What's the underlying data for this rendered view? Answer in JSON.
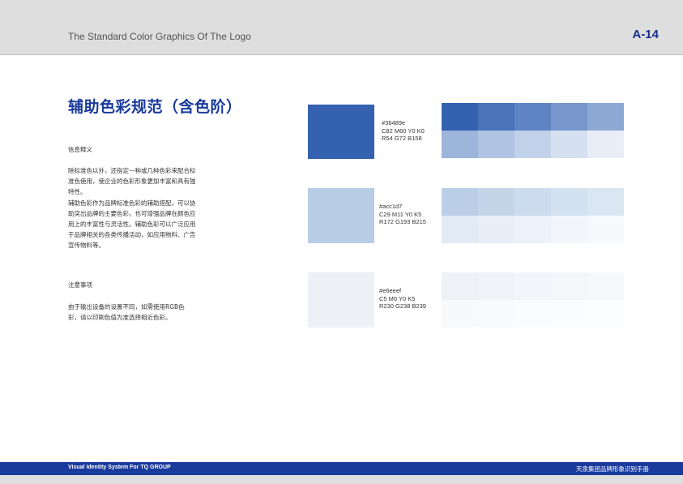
{
  "header": {
    "title": "The Standard Color Graphics Of The Logo",
    "page": "A-14"
  },
  "main_title": "辅助色彩规范（含色阶）",
  "sections": {
    "info_label": "信息释义",
    "info_lines": [
      "除标准色以外，还指定一种或几种色彩来配合标",
      "准色使用，使企业的色彩形象更加丰富和具有独",
      "特性。",
      "辅助色彩作为品牌标准色彩的辅助搭配，可以协",
      "助突出品牌的主要色彩，也可增强品牌在颜色应",
      "用上的丰富性与灵活性。辅助色彩可以广泛应用",
      "于品牌相关的各类传播活动，如应用物料、广告",
      "宣传物料等。"
    ],
    "note_label": "注意事项",
    "note_lines": [
      "由于输出设备的设置不同，如需使用RGB色",
      "彩，请以印刷色值为准选择相近色彩。"
    ]
  },
  "colors": [
    {
      "hex": "#36489e",
      "cmyk": "C82 M60 Y0 K0",
      "rgb": "R54 G72 B158",
      "swatch_color": "#3461b0",
      "tints": [
        [
          "#3461b0",
          "#4a73ba",
          "#5f84c3",
          "#7696cc",
          "#8ca8d5"
        ],
        [
          "#9db4db",
          "#b0c3e3",
          "#c2d1ea",
          "#d5e0f1",
          "#e8eef8"
        ]
      ]
    },
    {
      "hex": "#acc1d7",
      "cmyk": "C29 M11 Y0 K5",
      "rgb": "R172 G193 B215",
      "swatch_color": "#b7cde6",
      "tints": [
        [
          "#bacfe7",
          "#c4d5ea",
          "#ccdbed",
          "#d4e1f0",
          "#dbe6f3"
        ],
        [
          "#e1eaf5",
          "#e7eef7",
          "#ecf2f9",
          "#f2f6fb",
          "#f7f9fd"
        ]
      ]
    },
    {
      "hex": "#e6eeef",
      "cmyk": "C5 M0 Y0 K5",
      "rgb": "R230 G238 B239",
      "swatch_color": "#edf1f6",
      "tints": [
        [
          "#eef2f7",
          "#f0f4f8",
          "#f2f5f9",
          "#f4f7fa",
          "#f6f8fb"
        ],
        [
          "#f7f9fb",
          "#f8fafc",
          "#f9fbfc",
          "#fbfcfd",
          "#fcfdfe"
        ]
      ]
    }
  ],
  "footer": {
    "left": "Visual Identity System For TQ GROUP",
    "right": "天泉集团品牌形象识别手册"
  }
}
